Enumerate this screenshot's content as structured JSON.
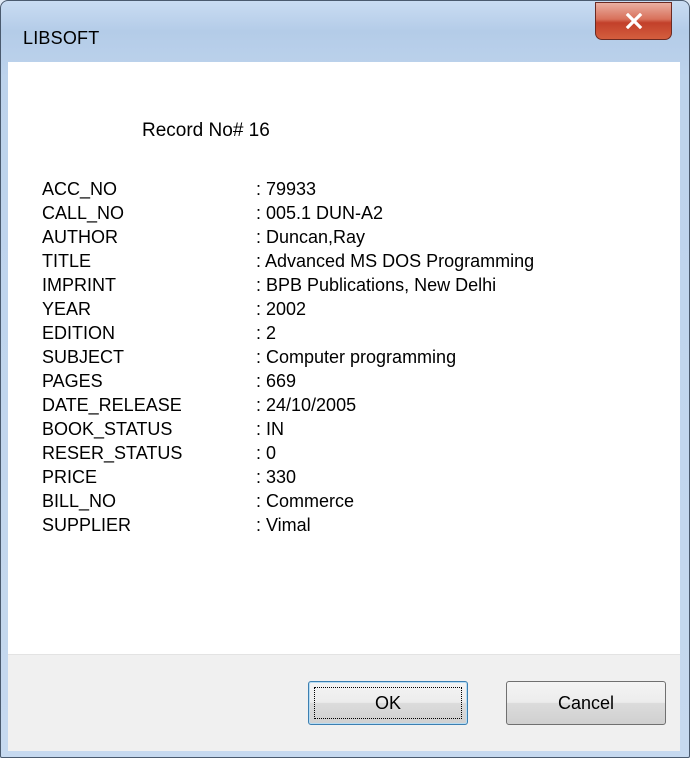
{
  "window": {
    "title": "LIBSOFT"
  },
  "header": {
    "record_label": "Record No# 16"
  },
  "fields": [
    {
      "label": "ACC_NO",
      "value": ": 79933"
    },
    {
      "label": "CALL_NO",
      "value": ": 005.1  DUN-A2"
    },
    {
      "label": "AUTHOR",
      "value": ": Duncan,Ray"
    },
    {
      "label": "TITLE",
      "value": ": Advanced MS DOS Programming"
    },
    {
      "label": "IMPRINT",
      "value": ": BPB Publications, New Delhi"
    },
    {
      "label": "YEAR",
      "value": ": 2002"
    },
    {
      "label": "EDITION",
      "value": ": 2"
    },
    {
      "label": "SUBJECT",
      "value": ": Computer programming"
    },
    {
      "label": "PAGES",
      "value": ": 669"
    },
    {
      "label": "DATE_RELEASE",
      "value": ": 24/10/2005"
    },
    {
      "label": "BOOK_STATUS",
      "value": ": IN"
    },
    {
      "label": "RESER_STATUS",
      "value": ": 0"
    },
    {
      "label": "PRICE",
      "value": ": 330"
    },
    {
      "label": "BILL_NO",
      "value": ": Commerce"
    },
    {
      "label": "SUPPLIER",
      "value": ": Vimal"
    }
  ],
  "buttons": {
    "ok": "OK",
    "cancel": "Cancel"
  },
  "icons": {
    "close": "close-icon"
  },
  "colors": {
    "close_button": "#c7472f",
    "frame": "#c6d9ef",
    "client": "#ffffff",
    "footer": "#f0f0f0"
  }
}
